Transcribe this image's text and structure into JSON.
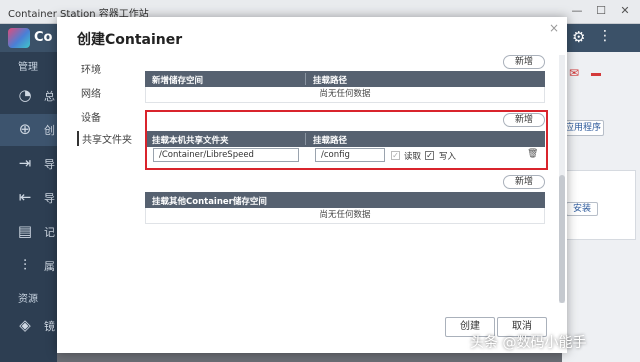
{
  "window": {
    "title": "Container Station 容器工作站"
  },
  "app": {
    "logo_text": "Co",
    "sections": {
      "manage": "管理",
      "resources": "资源"
    },
    "sidebar_items": [
      {
        "label": "总",
        "icon": "dashboard-icon"
      },
      {
        "label": "创",
        "icon": "plus-icon"
      },
      {
        "label": "导",
        "icon": "import-icon"
      },
      {
        "label": "导",
        "icon": "export-icon"
      },
      {
        "label": "记",
        "icon": "log-icon"
      },
      {
        "label": "属",
        "icon": "preferences-icon"
      },
      {
        "label": "镜",
        "icon": "image-icon"
      }
    ],
    "right_buttons": {
      "apps": "应用程序",
      "install": "安装"
    }
  },
  "dialog": {
    "title": "创建Container",
    "nav": [
      "环境",
      "网络",
      "设备",
      "共享文件夹"
    ],
    "active_nav": "共享文件夹",
    "new_volume": {
      "add_label": "新增",
      "col1": "新增储存空间",
      "col2": "挂载路径",
      "empty": "尚无任何数据"
    },
    "host_share": {
      "add_label": "新增",
      "col1": "挂载本机共享文件夹",
      "col2": "挂载路径",
      "host_path": "/Container/LibreSpeed",
      "mount_path": "/config",
      "read_label": "读取",
      "write_label": "写入",
      "read_checked": true,
      "write_checked": true
    },
    "other_volume": {
      "add_label": "新增",
      "col1": "挂载其他Container储存空间",
      "empty": "尚无任何数据"
    },
    "create_label": "创建",
    "cancel_label": "取消"
  },
  "watermark": "头条 @数码小能手"
}
